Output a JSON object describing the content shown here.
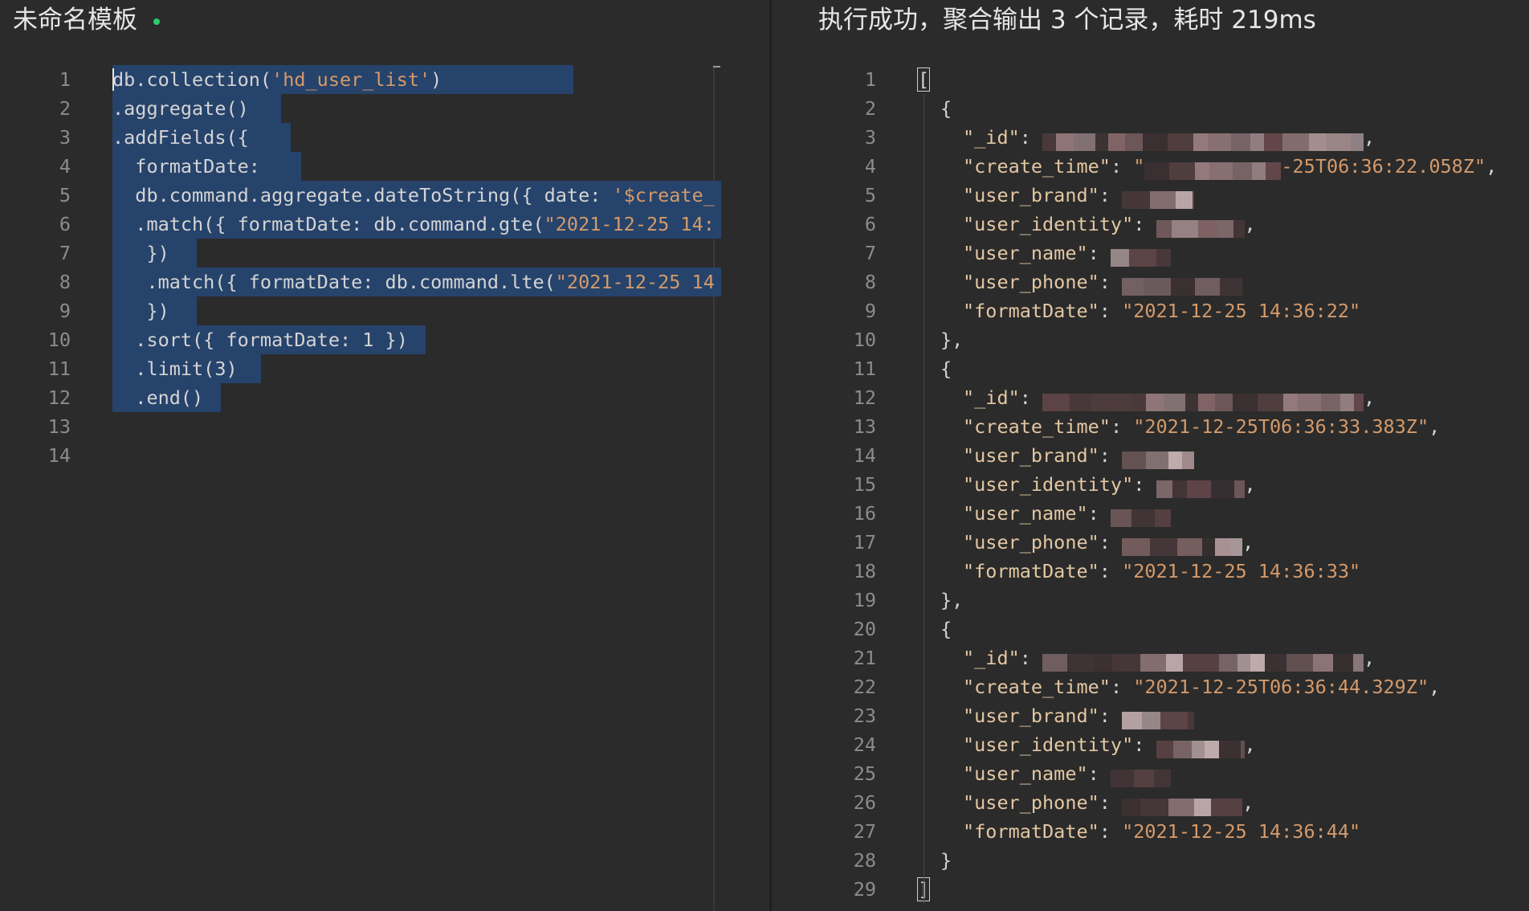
{
  "left_panel": {
    "title": "未命名模板",
    "lines": [
      {
        "n": "1",
        "text": "db.collection('hd_user_list')"
      },
      {
        "n": "2",
        "text": ".aggregate()"
      },
      {
        "n": "3",
        "text": ".addFields({"
      },
      {
        "n": "4",
        "text": "  formatDate:"
      },
      {
        "n": "5",
        "text": "  db.command.aggregate.dateToString({ date: '$create_"
      },
      {
        "n": "6",
        "text": "  .match({ formatDate: db.command.gte(\"2021-12-25 14:"
      },
      {
        "n": "7",
        "text": "   })"
      },
      {
        "n": "8",
        "text": "   .match({ formatDate: db.command.lte(\"2021-12-25 14"
      },
      {
        "n": "9",
        "text": "   })"
      },
      {
        "n": "10",
        "text": "  .sort({ formatDate: 1 })"
      },
      {
        "n": "11",
        "text": "  .limit(3)"
      },
      {
        "n": "12",
        "text": "  .end()"
      },
      {
        "n": "13",
        "text": ""
      },
      {
        "n": "14",
        "text": ""
      }
    ]
  },
  "right_panel": {
    "title": "执行成功，聚合输出 3 个记录，耗时 219ms",
    "line_numbers": [
      "1",
      "2",
      "3",
      "4",
      "5",
      "6",
      "7",
      "8",
      "9",
      "10",
      "11",
      "12",
      "13",
      "14",
      "15",
      "16",
      "17",
      "18",
      "19",
      "20",
      "21",
      "22",
      "23",
      "24",
      "25",
      "26",
      "27",
      "28",
      "29"
    ],
    "records": [
      {
        "create_time_visible": "\"…-25T06:36:22.058Z\"",
        "formatDate": "\"2021-12-25 14:36:22\""
      },
      {
        "create_time_visible": "\"2021-12-25T06:36:33.383Z\"",
        "formatDate": "\"2021-12-25 14:36:33\""
      },
      {
        "create_time_visible": "\"2021-12-25T06:36:44.329Z\"",
        "formatDate": "\"2021-12-25 14:36:44\""
      }
    ],
    "keys": {
      "id": "\"_id\"",
      "create_time": "\"create_time\"",
      "user_brand": "\"user_brand\"",
      "user_identity": "\"user_identity\"",
      "user_name": "\"user_name\"",
      "user_phone": "\"user_phone\"",
      "formatDate": "\"formatDate\""
    }
  },
  "colors": {
    "background": "#2b2b2b",
    "selection": "#26436b",
    "string": "#d49a6b",
    "status_dot": "#2ecc71"
  }
}
